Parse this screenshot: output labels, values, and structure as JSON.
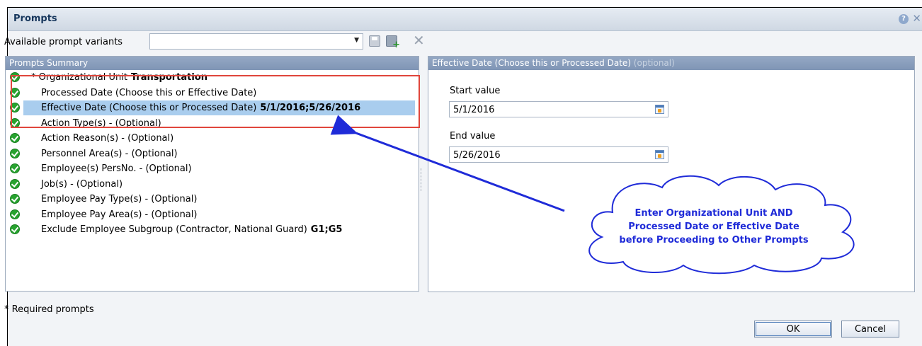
{
  "window": {
    "title": "Prompts",
    "help_glyph": "?",
    "close_glyph": "✕"
  },
  "variants": {
    "label": "Available prompt variants",
    "selected": "",
    "dropdown_glyph": "▼",
    "delete_glyph": "✕"
  },
  "summary": {
    "header": "Prompts Summary",
    "rows": [
      {
        "label": "* Organizational Unit",
        "value": "Transportation"
      },
      {
        "label": "Processed Date (Choose this or Effective Date)",
        "value": ""
      },
      {
        "label": "Effective Date (Choose this or Processed Date)",
        "value": "5/1/2016;5/26/2016"
      },
      {
        "label": "Action Type(s) - (Optional)",
        "value": ""
      },
      {
        "label": "Action Reason(s) - (Optional)",
        "value": ""
      },
      {
        "label": "Personnel Area(s) - (Optional)",
        "value": ""
      },
      {
        "label": "Employee(s) PersNo. - (Optional)",
        "value": ""
      },
      {
        "label": "Job(s) - (Optional)",
        "value": ""
      },
      {
        "label": "Employee Pay Type(s) - (Optional)",
        "value": ""
      },
      {
        "label": "Employee Pay Area(s) - (Optional)",
        "value": ""
      },
      {
        "label": "Exclude Employee Subgroup (Contractor, National Guard)",
        "value": "G1;G5"
      }
    ],
    "required_note": "* Required prompts"
  },
  "detail": {
    "header": "Effective Date (Choose this or Processed Date)",
    "header_optional": "(optional)",
    "start_label": "Start value",
    "start_value": "5/1/2016",
    "end_label": "End value",
    "end_value": "5/26/2016"
  },
  "callout": {
    "line1": "Enter Organizational Unit AND",
    "line2": "Processed Date or Effective Date",
    "line3": "before Proceeding to Other Prompts",
    "text_color": "#1f2bd8",
    "arrow_color": "#1f2bd8",
    "highlight_color": "#e0463c"
  },
  "buttons": {
    "ok": "OK",
    "cancel": "Cancel"
  }
}
